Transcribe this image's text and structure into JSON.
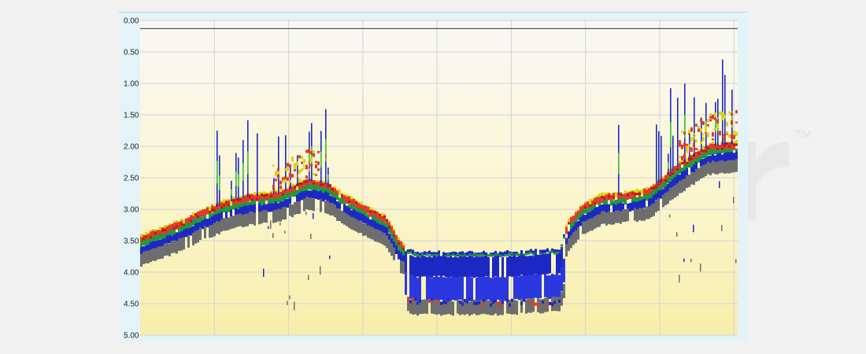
{
  "chart_data": {
    "type": "heatmap",
    "title": "",
    "xlabel": "",
    "ylabel": "",
    "y_axis": {
      "ticks": [
        "0.00",
        "0.50",
        "1.00",
        "1.50",
        "2.00",
        "2.50",
        "3.00",
        "3.50",
        "4.00",
        "4.50",
        "5.00"
      ],
      "range": [
        0,
        5
      ],
      "inverted": true
    },
    "x_axis": {
      "vertical_gridlines": 8,
      "tick_labels": []
    },
    "grid": true,
    "surface_line_depth": 0.13,
    "bottom_profile": {
      "description_free": true,
      "x_fraction": [
        0.0,
        0.07,
        0.1,
        0.14,
        0.18,
        0.23,
        0.28,
        0.31,
        0.34,
        0.38,
        0.41,
        0.43,
        0.445,
        0.46,
        0.6,
        0.7,
        0.715,
        0.74,
        0.77,
        0.82,
        0.85,
        0.87,
        0.9,
        0.95,
        1.0
      ],
      "depth": [
        3.45,
        3.2,
        3.05,
        2.9,
        2.8,
        2.75,
        2.55,
        2.6,
        2.8,
        3.0,
        3.15,
        3.5,
        3.65,
        3.7,
        3.7,
        3.65,
        3.2,
        2.95,
        2.8,
        2.75,
        2.7,
        2.55,
        2.3,
        2.0,
        1.95
      ]
    },
    "color_scale": [
      "#a3a3a3",
      "#6e6e6e",
      "#1d28c4",
      "#2b38e0",
      "#1f9a3c",
      "#3fc23a",
      "#d8d416",
      "#e23a2a",
      "#c01818"
    ],
    "background_gradient": [
      "#f8f7f6",
      "#fbf7d7",
      "#f8eeaa"
    ]
  }
}
